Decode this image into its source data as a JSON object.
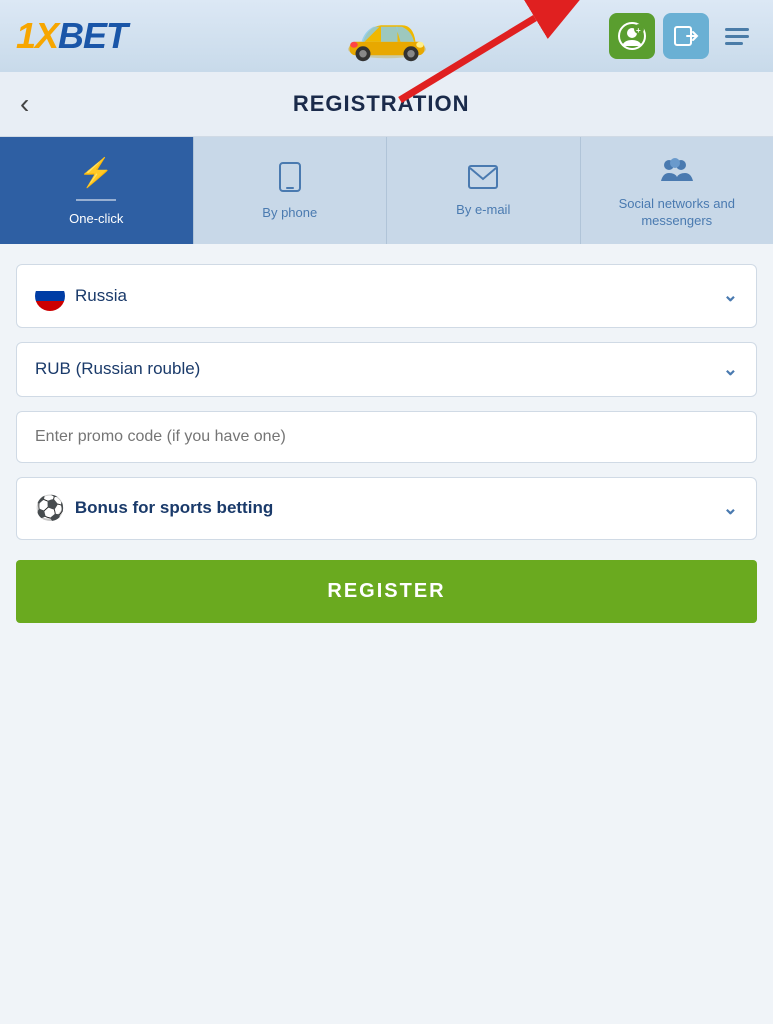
{
  "header": {
    "logo": "1XBET",
    "logo_x": "1X",
    "logo_bet": "BET"
  },
  "page_title": "REGISTRATION",
  "back_button": "‹",
  "tabs": [
    {
      "id": "one-click",
      "label": "One-click",
      "icon": "⚡",
      "active": true
    },
    {
      "id": "by-phone",
      "label": "By phone",
      "icon": "📱",
      "active": false
    },
    {
      "id": "by-email",
      "label": "By e-mail",
      "icon": "✉",
      "active": false
    },
    {
      "id": "social",
      "label": "Social networks and messengers",
      "icon": "👥",
      "active": false
    }
  ],
  "form": {
    "country": {
      "value": "Russia",
      "flag": "russia"
    },
    "currency": {
      "value": "RUB (Russian rouble)"
    },
    "promo": {
      "placeholder": "Enter promo code (if you have one)"
    },
    "bonus": {
      "label": "Bonus for sports betting",
      "icon": "⚽"
    },
    "register_button": "REGISTER"
  }
}
